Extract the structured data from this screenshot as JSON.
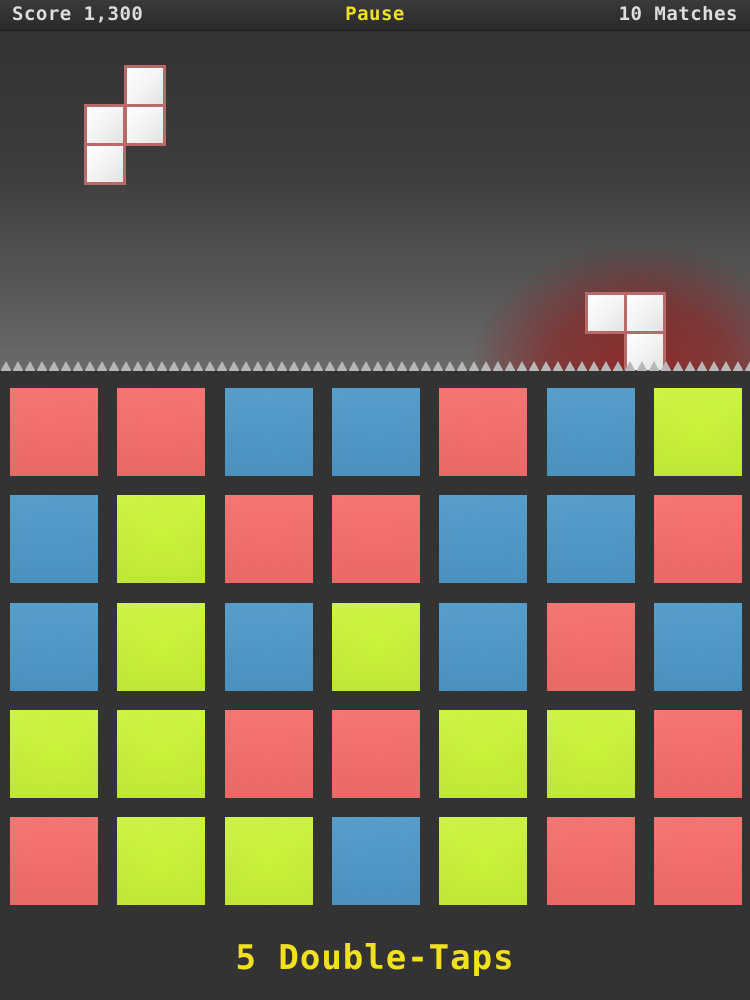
{
  "hud": {
    "score": "Score 1,300",
    "pause": "Pause",
    "matches": "10 Matches"
  },
  "footer": {
    "double_taps": "5 Double-Taps"
  },
  "colors": {
    "red": "#f36e6a",
    "blue": "#4e98c9",
    "green": "#c9f23a",
    "hud_accent": "#f0e020"
  },
  "falling_pieces": [
    {
      "name": "s-piece",
      "color": "white",
      "cells": 4
    },
    {
      "name": "l-piece",
      "color": "white",
      "cells": 3,
      "highlight": "red-glow"
    }
  ],
  "board": {
    "rows": 5,
    "cols": 7,
    "grid": [
      [
        "red",
        "red",
        "blue",
        "blue",
        "red",
        "blue",
        "green"
      ],
      [
        "blue",
        "green",
        "red",
        "red",
        "blue",
        "blue",
        "red"
      ],
      [
        "blue",
        "green",
        "blue",
        "green",
        "blue",
        "red",
        "blue"
      ],
      [
        "green",
        "green",
        "red",
        "red",
        "green",
        "green",
        "red"
      ],
      [
        "red",
        "green",
        "green",
        "blue",
        "green",
        "red",
        "red"
      ]
    ]
  }
}
